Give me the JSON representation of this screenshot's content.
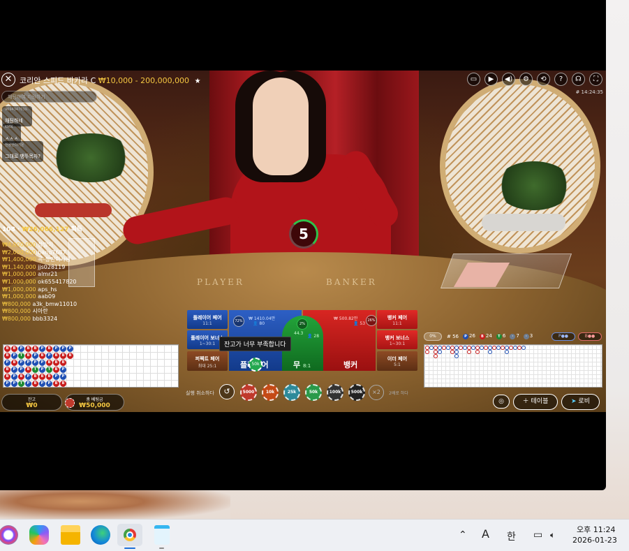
{
  "window": {
    "title": "코리안 스피드 바카라 C",
    "limits": "₩10,000 - 200,000,000",
    "game_id": "# 14:24:35"
  },
  "toolbar": {
    "icons": [
      "chat-icon",
      "video-icon",
      "volume-icon",
      "settings-icon",
      "history-icon",
      "help-icon",
      "headset-icon",
      "fullscreen-icon"
    ],
    "glyphs": [
      "▭",
      "▶",
      "◀)",
      "⚙",
      "⟲",
      "?",
      "☊",
      "⛶"
    ]
  },
  "chat": {
    "placeholder": "채팅하여 지원하기",
    "messages": [
      {
        "user": "9694347039..",
        "text": "채팅하네"
      },
      {
        "user": "KMN",
        "text": "ㅅㅅㅅ"
      },
      {
        "user": "천왕안다기운",
        "text": "그대로 뱅뚜목자?"
      }
    ]
  },
  "winners": {
    "count": "108",
    "total": "₩26,066,127",
    "suffix": "획득",
    "list": [
      {
        "amount": "₩4,000,000",
        "name": "창망이"
      },
      {
        "amount": "₩2,000,000",
        "name": "bang7687"
      },
      {
        "amount": "₩1,400,000",
        "name": "콕-장인이사랑"
      },
      {
        "amount": "₩1,140,000",
        "name": "jjs028119"
      },
      {
        "amount": "₩1,000,000",
        "name": "almr21"
      },
      {
        "amount": "₩1,000,000",
        "name": "ok655417820"
      },
      {
        "amount": "₩1,000,000",
        "name": "aps_hs"
      },
      {
        "amount": "₩1,000,000",
        "name": "aab09"
      },
      {
        "amount": "₩800,000",
        "name": "a3k_bmw11010"
      },
      {
        "amount": "₩800,000",
        "name": "시아란"
      },
      {
        "amount": "₩800,000",
        "name": "bbb3324"
      }
    ]
  },
  "timer": {
    "seconds": "5"
  },
  "felt": {
    "player": "PLAYER",
    "banker": "BANKER"
  },
  "bets": {
    "player_pair": {
      "name": "플레이어 페어",
      "odds": "11:1"
    },
    "player_bonus": {
      "name": "플레이어 보너스",
      "odds": "1~30:1"
    },
    "perfect_pair": {
      "name": "퍼펙트 페어",
      "odds": "최대 25:1"
    },
    "banker_pair": {
      "name": "뱅커 페어",
      "odds": "11:1"
    },
    "banker_bonus": {
      "name": "뱅커 보너스",
      "odds": "1~30:1"
    },
    "either_pair": {
      "name": "이더 페어",
      "odds": "5:1"
    },
    "player": {
      "name": "플레이어",
      "odds": "",
      "pct": "72%",
      "amount": "₩ 1410.04만",
      "players": "80"
    },
    "tie": {
      "name": "무",
      "odds": "8:1",
      "pct": "2%",
      "amount": "44.3",
      "players": "28"
    },
    "banker": {
      "name": "뱅커",
      "odds": "",
      "pct": "26%",
      "amount": "₩ 500.82만",
      "players": "53"
    }
  },
  "tooltip": "잔고가 너무 부족합니다",
  "table_chip": "50k",
  "road_stats": {
    "pct": "0%",
    "round": "# 56",
    "player": "26",
    "banker": "24",
    "tie": "6",
    "player_pair": "7",
    "banker_pair": "3"
  },
  "balance": {
    "label": "잔고",
    "value": "₩0"
  },
  "total_bet": {
    "label": "총 베팅금",
    "value": "₩50,000"
  },
  "controls": {
    "undo_label": "실행 취소하다",
    "double": "×2",
    "repeat_label": "2배로 하다",
    "chips": [
      {
        "label": "5000",
        "color": "#c0392b"
      },
      {
        "label": "10k",
        "color": "#c44a16"
      },
      {
        "label": "25k",
        "color": "#2d8a9a"
      },
      {
        "label": "50k",
        "color": "#2a9a4a"
      },
      {
        "label": "100k",
        "color": "#333333"
      },
      {
        "label": "500k",
        "color": "#222222"
      }
    ],
    "table_button": "테이블",
    "lobby_button": "로비"
  },
  "taskbar": {
    "apps": [
      "widgets-app",
      "copilot-app",
      "file-explorer-app",
      "edge-app",
      "chrome-app",
      "notepad-app"
    ],
    "ime_mode": "A",
    "ime_lang": "한",
    "time": "오후 11:24",
    "date": "2026-01-23"
  },
  "colors": {
    "player": "#1f4fb3",
    "banker": "#c81c1c",
    "tie": "#1d8a32",
    "gold": "#f5c842"
  }
}
